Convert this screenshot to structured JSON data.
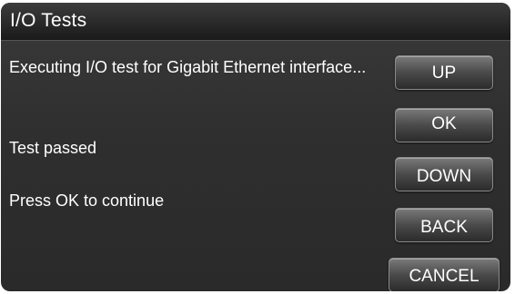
{
  "window": {
    "title": "I/O Tests"
  },
  "messages": {
    "executing": "Executing I/O test for Gigabit Ethernet interface...",
    "result": "Test passed",
    "instruction": "Press OK to continue"
  },
  "buttons": {
    "up": "UP",
    "ok": "OK",
    "down": "DOWN",
    "back": "BACK",
    "cancel": "CANCEL"
  },
  "colors": {
    "background": "#2f2f2f",
    "text": "#ffffff",
    "button": "#4a4a4a"
  }
}
